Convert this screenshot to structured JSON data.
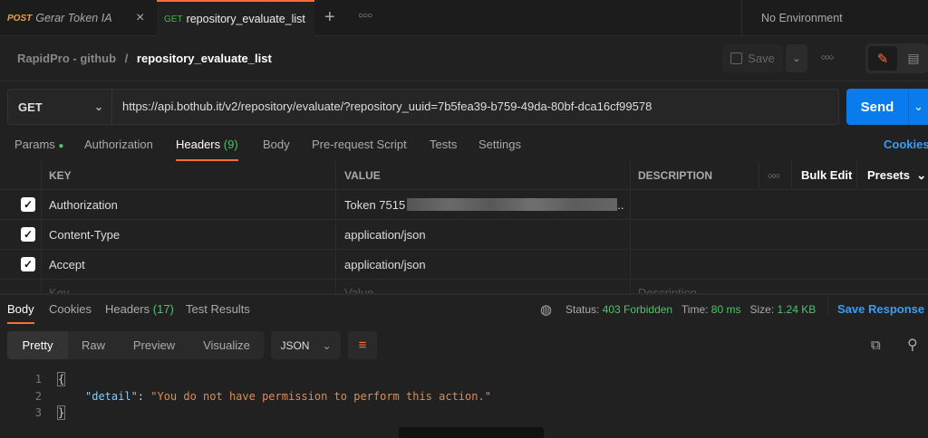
{
  "tabs": [
    {
      "method": "POST",
      "name": "Gerar Token IA"
    },
    {
      "method": "GET",
      "name": "repository_evaluate_list"
    }
  ],
  "environment": "No Environment",
  "breadcrumb": {
    "collection": "RapidPro - github",
    "separator": "/",
    "request": "repository_evaluate_list"
  },
  "save_label": "Save",
  "method": "GET",
  "url": "https://api.bothub.it/v2/repository/evaluate/?repository_uuid=7b5fea39-b759-49da-80bf-dca16cf99578",
  "send_label": "Send",
  "request_tabs": [
    "Params",
    "Authorization",
    "Headers",
    "Body",
    "Pre-request Script",
    "Tests",
    "Settings"
  ],
  "headers_count": "(9)",
  "cookies_link": "Cookies",
  "table": {
    "columns": [
      "KEY",
      "VALUE",
      "DESCRIPTION"
    ],
    "bulk_edit": "Bulk Edit",
    "presets": "Presets",
    "rows": [
      {
        "key": "Authorization",
        "value": "Token 7515",
        "truncated": ".."
      },
      {
        "key": "Content-Type",
        "value": "application/json"
      },
      {
        "key": "Accept",
        "value": "application/json"
      }
    ],
    "placeholder": {
      "key": "Key",
      "value": "Value",
      "description": "Description"
    }
  },
  "response": {
    "tabs": [
      "Body",
      "Cookies",
      "Headers",
      "Test Results"
    ],
    "headers_count": "(17)",
    "status_label": "Status:",
    "status": "403 Forbidden",
    "time_label": "Time:",
    "time": "80 ms",
    "size_label": "Size:",
    "size": "1.24 KB",
    "save_response": "Save Response",
    "views": [
      "Pretty",
      "Raw",
      "Preview",
      "Visualize"
    ],
    "format": "JSON",
    "lines": [
      "1",
      "2",
      "3"
    ],
    "code": {
      "open": "{",
      "key": "\"detail\"",
      "colon": ": ",
      "value": "\"You do not have permission to perform this action.\"",
      "close": "}"
    }
  },
  "colors": {
    "accent": "#ff6c37",
    "blue": "#097bed",
    "green": "#4fc26b"
  }
}
